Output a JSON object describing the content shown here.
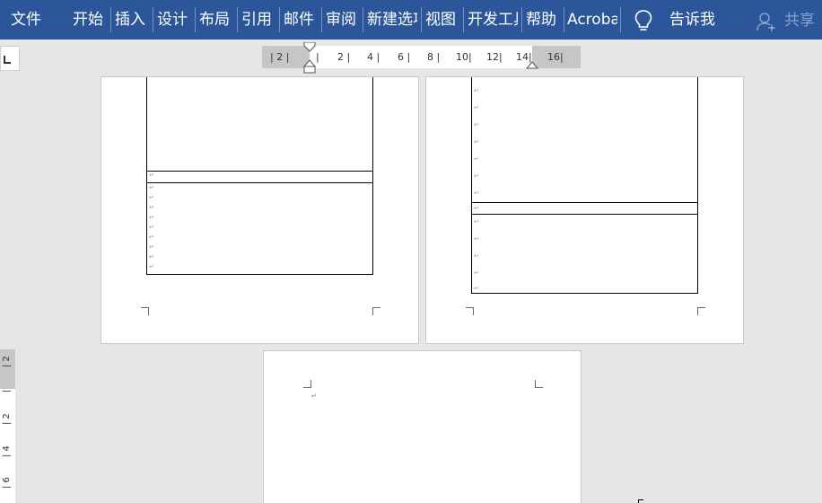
{
  "ribbon": {
    "tabs": [
      "文件",
      "开始",
      "插入",
      "设计",
      "布局",
      "引用",
      "邮件",
      "审阅",
      "新建选项卡",
      "视图",
      "开发工具",
      "帮助",
      "Acrobat"
    ],
    "tell_me": "告诉我",
    "share": "共享",
    "accent": "#2b579a"
  },
  "ruler": {
    "horizontal_labels": [
      "2",
      "2",
      "4",
      "6",
      "8",
      "10",
      "12",
      "14",
      "16"
    ],
    "vertical_labels": [
      "2",
      "2",
      "4",
      "6"
    ]
  },
  "paragraph_mark": "↵"
}
